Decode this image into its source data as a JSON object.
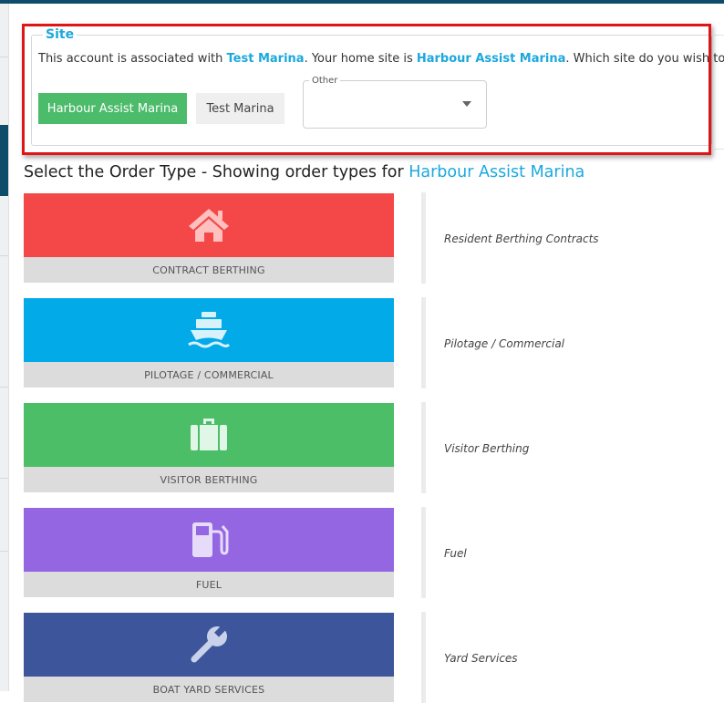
{
  "site": {
    "legend": "Site",
    "message_prefix": "This account is associated with ",
    "associated_site": "Test Marina",
    "message_middle": ". Your home site is ",
    "home_site": "Harbour Assist Marina",
    "message_suffix": ". Which site do you wish to use?",
    "buttons": [
      "Harbour Assist Marina",
      "Test Marina"
    ],
    "other_select": {
      "label": "Other",
      "value": ""
    }
  },
  "order_type": {
    "heading_prefix": "Select the Order Type - Showing order types for ",
    "heading_site": "Harbour Assist Marina",
    "items": [
      {
        "label": "CONTRACT BERTHING",
        "description": "Resident Berthing Contracts",
        "color": "#f44848",
        "icon": "house-icon"
      },
      {
        "label": "PILOTAGE / COMMERCIAL",
        "description": "Pilotage / Commercial",
        "color": "#03aae8",
        "icon": "ship-icon"
      },
      {
        "label": "VISITOR BERTHING",
        "description": "Visitor Berthing",
        "color": "#4cbe67",
        "icon": "suitcase-icon"
      },
      {
        "label": "FUEL",
        "description": "Fuel",
        "color": "#9466e2",
        "icon": "fuel-pump-icon"
      },
      {
        "label": "BOAT YARD SERVICES",
        "description": "Yard Services",
        "color": "#3d569b",
        "icon": "wrench-icon"
      }
    ]
  },
  "colors": {
    "accent": "#1ca8dd",
    "highlight_border": "#e01616",
    "primary_button": "#4cbb6a"
  }
}
